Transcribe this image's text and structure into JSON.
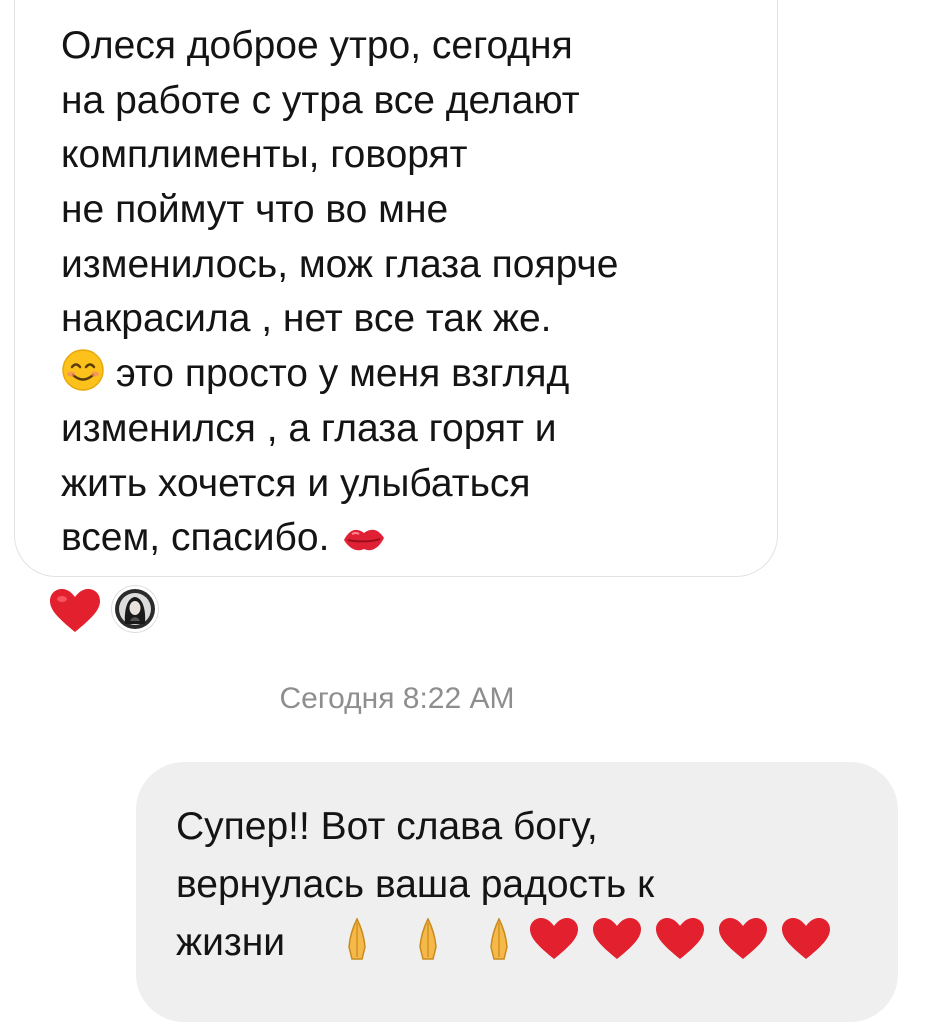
{
  "received_message": {
    "lines": [
      "Олеся доброе утро, сегодня",
      "на работе с утра все делают",
      "комплименты, говорят",
      "не поймут что во мне",
      "изменилось, мож глаза поярче",
      "накрасила , нет все так же.",
      "это просто у меня взгляд",
      "изменился , а глаза горят и",
      "жить хочется и улыбаться",
      "всем, спасибо."
    ],
    "emoji_line7_icon": "smiling-face-icon",
    "emoji_line10_icon": "kiss-lips-icon"
  },
  "reactions": {
    "emoji_icon": "red-heart-icon",
    "avatar_icon": "reactor-avatar"
  },
  "timestamp": "Сегодня 8:22 AM",
  "sent_message": {
    "lines": [
      "Супер!! Вот слава богу,",
      "вернулась ваша радость к",
      "жизни"
    ],
    "trailing_emoji_icons": [
      "folded-hands-icon",
      "folded-hands-icon",
      "folded-hands-icon",
      "red-heart-icon",
      "red-heart-icon",
      "red-heart-icon",
      "red-heart-icon",
      "red-heart-icon"
    ]
  },
  "colors": {
    "incoming_bubble_border": "#e2e2e2",
    "outgoing_bubble_bg": "#efefef",
    "timestamp_text": "#8e8e8e",
    "heart": "#e3202d"
  }
}
